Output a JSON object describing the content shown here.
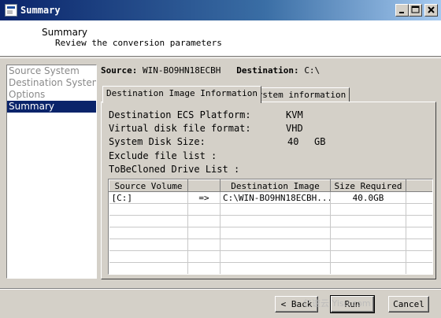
{
  "window": {
    "title": "Summary",
    "minimize_icon": "minimize-icon",
    "maximize_icon": "maximize-icon",
    "close_icon": "close-icon"
  },
  "header": {
    "title": "Summary",
    "subtitle": "Review the conversion parameters"
  },
  "sidebar": {
    "items": [
      {
        "label": "Source System"
      },
      {
        "label": "Destination System"
      },
      {
        "label": "Options"
      },
      {
        "label": "Summary"
      }
    ],
    "selected": "Summary"
  },
  "info": {
    "source_label": "Source:",
    "source_value": "WIN-BO9HN18ECBH",
    "destination_label": "Destination:",
    "destination_value": "C:\\"
  },
  "tabs": [
    {
      "label": "Destination Image Information"
    },
    {
      "label": "system information"
    }
  ],
  "details": {
    "platform_label": "Destination ECS Platform:",
    "platform_value": "KVM",
    "format_label": "Virtual disk file format:",
    "format_value": "VHD",
    "disk_size_label": "System Disk Size:",
    "disk_size_value": "40",
    "disk_size_unit": "GB",
    "exclude_label": "Exclude file list :",
    "drive_list_label": "ToBeCloned Drive List :"
  },
  "table": {
    "columns": [
      "Source Volume",
      "",
      "Destination Image",
      "Size Required"
    ],
    "rows": [
      [
        "[C:]",
        "=>",
        "C:\\WIN-BO9HN18ECBH...",
        "40.0GB"
      ]
    ]
  },
  "buttons": {
    "back": "< Back",
    "run": "Run",
    "cancel": "Cancel"
  },
  "watermark": "亿速云 Yisu.com"
}
